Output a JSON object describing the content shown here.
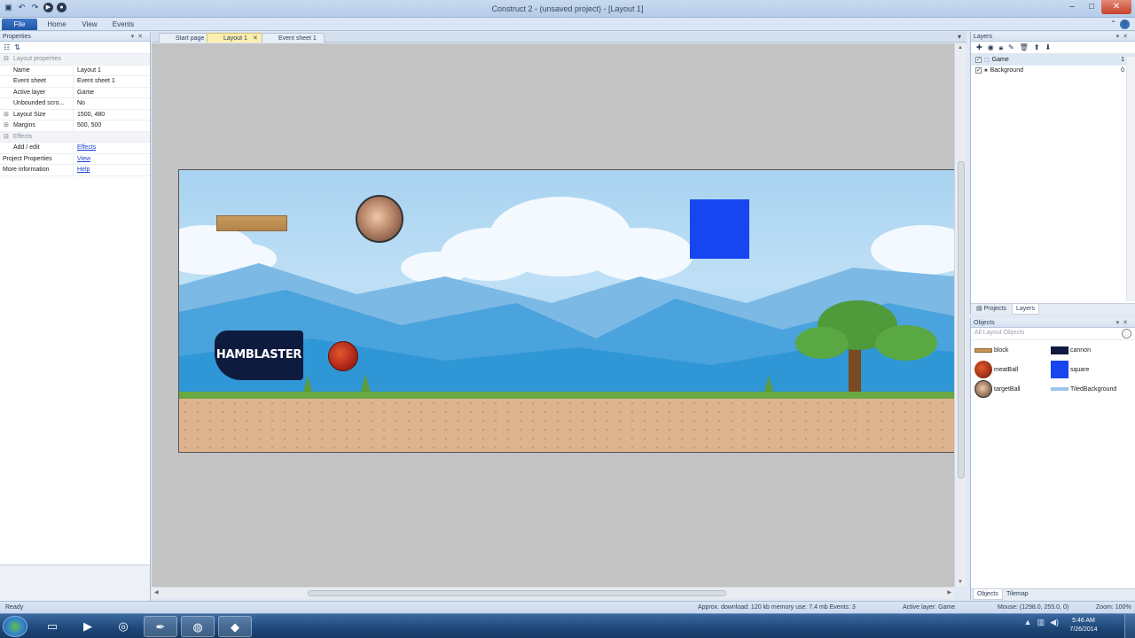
{
  "window": {
    "title": "Construct 2 - (unsaved project) - [Layout 1]"
  },
  "ribbon": {
    "tabs": [
      "File",
      "Home",
      "View",
      "Events"
    ]
  },
  "properties": {
    "title": "Properties",
    "rows": [
      {
        "key": "Layout properties",
        "value": "",
        "type": "category"
      },
      {
        "key": "Name",
        "value": "Layout 1"
      },
      {
        "key": "Event sheet",
        "value": "Event sheet 1"
      },
      {
        "key": "Active layer",
        "value": "Game"
      },
      {
        "key": "Unbounded scro...",
        "value": "No"
      },
      {
        "key": "Layout Size",
        "value": "1500, 480",
        "expand": true
      },
      {
        "key": "Margins",
        "value": "500, 500",
        "expand": true
      },
      {
        "key": "Effects",
        "value": "",
        "type": "category"
      },
      {
        "key": "Add / edit",
        "value": "Effects",
        "link": true
      },
      {
        "key": "Project Properties",
        "value": "View",
        "link": true,
        "root": true
      },
      {
        "key": "More information",
        "value": "Help",
        "link": true,
        "root": true
      }
    ]
  },
  "doc_tabs": [
    {
      "label": "Start page",
      "active": false
    },
    {
      "label": "Layout 1",
      "active": true
    },
    {
      "label": "Event sheet 1",
      "active": false
    }
  ],
  "layout_objects": {
    "cannon_text": "HAMBLASTER"
  },
  "layers": {
    "title": "Layers",
    "rows": [
      {
        "name": "Game",
        "number": "1",
        "selected": true
      },
      {
        "name": "Background",
        "number": "0",
        "selected": false
      }
    ],
    "bottom_tabs": [
      "Projects",
      "Layers"
    ]
  },
  "objects": {
    "title": "Objects",
    "search_placeholder": "All Layout Objects",
    "items": [
      {
        "name": "block",
        "icon": "block-icon"
      },
      {
        "name": "cannon",
        "icon": "cannon-icon"
      },
      {
        "name": "meatBall",
        "icon": "meatball-icon"
      },
      {
        "name": "square",
        "icon": "square-icon"
      },
      {
        "name": "targetBall",
        "icon": "targetball-icon"
      },
      {
        "name": "TiledBackground",
        "icon": "tiledbackground-icon"
      }
    ],
    "bottom_tabs": [
      "Objects",
      "Tilemap"
    ]
  },
  "statusbar": {
    "ready": "Ready",
    "download": "Approx. download: 120 kb  memory use: 7.4 mb  Events: 3",
    "active_layer": "Active layer: Game",
    "mouse": "Mouse: (1298.0, 255.0, 0)",
    "zoom": "Zoom: 100%"
  },
  "taskbar": {
    "time": "5:46 AM",
    "date": "7/26/2014",
    "items": [
      "explorer-icon",
      "media-player-icon",
      "chrome-icon",
      "pen-icon",
      "construct-icon",
      "app-icon"
    ]
  },
  "colors": {
    "square": "#1745f0",
    "accent": "#1f56a6"
  }
}
